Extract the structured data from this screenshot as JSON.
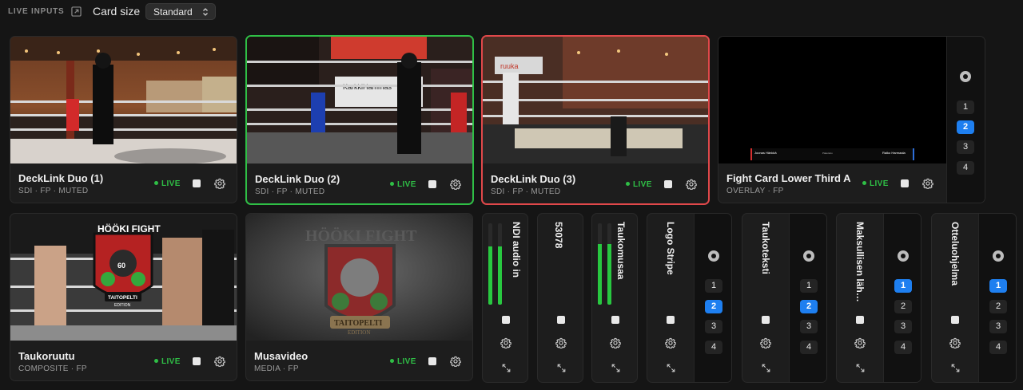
{
  "toolbar": {
    "section_label": "LIVE INPUTS",
    "popout_icon": "popout-icon",
    "card_size_label": "Card size",
    "card_size_value": "Standard"
  },
  "live_label": "LIVE",
  "layers": [
    "1",
    "2",
    "3",
    "4"
  ],
  "cards": {
    "decklink1": {
      "name": "DeckLink Duo (1)",
      "sub": "SDI · FP · MUTED",
      "live": true,
      "state": "none"
    },
    "decklink2": {
      "name": "DeckLink Duo (2)",
      "sub": "SDI · FP · MUTED",
      "live": true,
      "state": "program"
    },
    "decklink3": {
      "name": "DeckLink Duo (3)",
      "sub": "SDI · FP · MUTED",
      "live": true,
      "state": "preview"
    },
    "fightcard": {
      "name": "Fight Card Lower Third A",
      "sub": "OVERLAY · FP",
      "live": true,
      "active_layer": "2",
      "overlay": {
        "left_name": "Joonas Hänkkä",
        "mid_text": "Pääottelu",
        "right_name": "Raiko Harmaala"
      }
    },
    "taukoruutu": {
      "name": "Taukoruutu",
      "sub": "COMPOSITE · FP",
      "live": true
    },
    "musavideo": {
      "name": "Musavideo",
      "sub": "MEDIA · FP",
      "live": true
    }
  },
  "thumb_text": {
    "banner_1": "KarkkiHammas",
    "banner_2": "ruuka",
    "logo_title": "HÖÖKI FIGHT",
    "logo_ribbon": "TAITOPELTI",
    "logo_sub": "EDITION",
    "logo_badge": "60"
  },
  "narrow": {
    "ndi": {
      "name": "NDI audio in",
      "meter_levels": [
        0.72,
        0.72
      ]
    },
    "n53078": {
      "name": "53078"
    },
    "taukomusaa": {
      "name": "Taukomusaa",
      "meter_levels": [
        0.75,
        0.75
      ]
    },
    "logostripe": {
      "name": "Logo Stripe",
      "active_layer": "2"
    },
    "taukoteksti": {
      "name": "Taukoteksti",
      "active_layer": "2"
    },
    "maksullisen": {
      "name": "Maksullisen läh…",
      "active_layer": "1"
    },
    "otteluohjelma": {
      "name": "Otteluohjelma",
      "active_layer": "1"
    }
  },
  "colors": {
    "program": "#2fbf46",
    "preview": "#e0484a",
    "live": "#2fbf46",
    "layer_active": "#1e7ff0",
    "meter": "#28c840"
  }
}
